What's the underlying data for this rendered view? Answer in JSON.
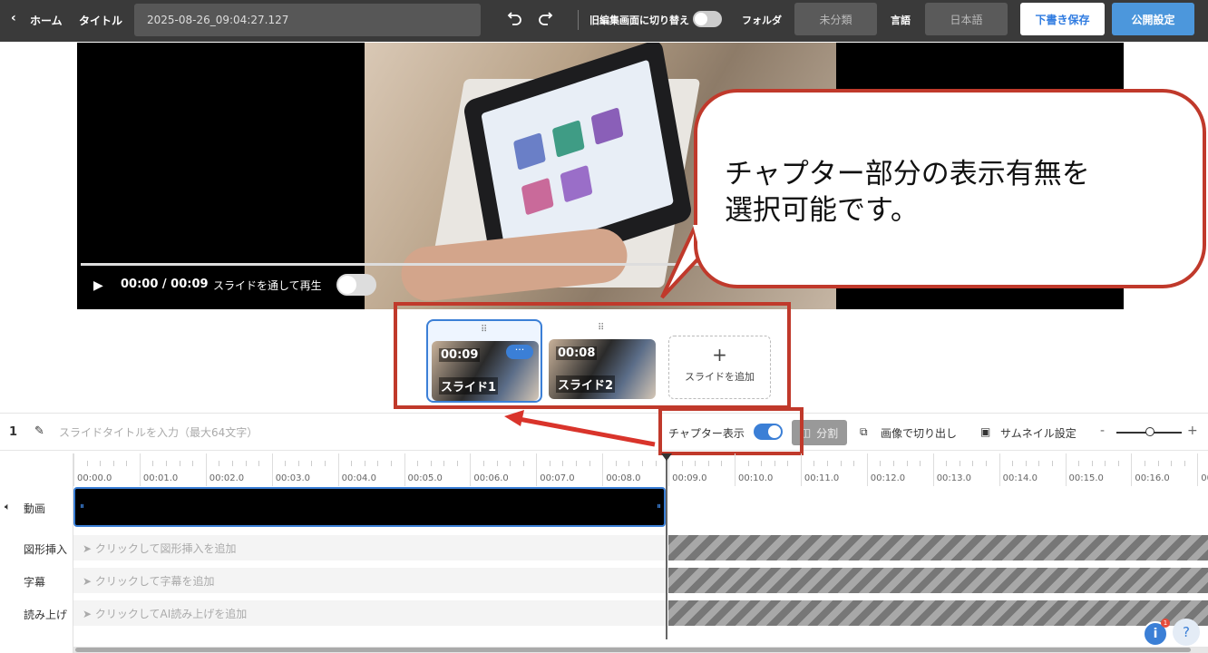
{
  "topbar": {
    "back_label": "ホーム",
    "title_label": "タイトル",
    "title_value": "2025-08-26_09:04:27.127",
    "old_editor_label": "旧編集画面に切り替え",
    "old_editor_on": false,
    "folder_label": "フォルダ",
    "folder_value": "未分類",
    "language_label": "言語",
    "language_value": "日本語",
    "save_draft_label": "下書き保存",
    "publish_label": "公開設定"
  },
  "player": {
    "time": "00:00 / 00:09",
    "play_through_label": "スライドを通して再生",
    "play_through_on": false
  },
  "callout": {
    "line1": "チャプター部分の表示有無を",
    "line2": "選択可能です。"
  },
  "slides": [
    {
      "duration": "00:09",
      "name": "スライド1",
      "active": true
    },
    {
      "duration": "00:08",
      "name": "スライド2",
      "active": false
    }
  ],
  "add_slide_label": "スライドを追加",
  "toolbar": {
    "slide_number": "1",
    "title_placeholder": "スライドタイトルを入力（最大64文字）",
    "chapter_label": "チャプター表示",
    "chapter_on": true,
    "split_label": "分割",
    "crop_label": "画像で切り出し",
    "thumbnail_label": "サムネイル設定",
    "zoom_minus": "-",
    "zoom_plus": "+"
  },
  "ruler": [
    "00:00.0",
    "00:01.0",
    "00:02.0",
    "00:03.0",
    "00:04.0",
    "00:05.0",
    "00:06.0",
    "00:07.0",
    "00:08.0",
    "00:09.0",
    "00:10.0",
    "00:11.0",
    "00:12.0",
    "00:13.0",
    "00:14.0",
    "00:15.0",
    "00:16.0",
    "00"
  ],
  "tracks": {
    "video_label": "動画",
    "shape_label": "図形挿入",
    "shape_hint": "クリックして図形挿入を追加",
    "subtitle_label": "字幕",
    "subtitle_hint": "クリックして字幕を追加",
    "narration_label": "読み上げ",
    "narration_hint": "クリックしてAI読み上げを追加"
  },
  "info_badge": "1",
  "help_label": "?"
}
